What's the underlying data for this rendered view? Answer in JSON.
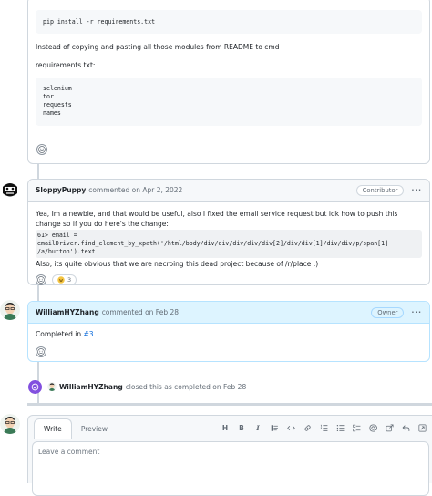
{
  "first_comment": {
    "code1": "pip install -r requirements.txt",
    "para1": "Instead of copying and pasting all those modules from README to cmd",
    "para2": "requirements.txt:",
    "code2_lines": [
      "selenium",
      "tor",
      "requests",
      "names"
    ]
  },
  "comment2": {
    "author": "SloppyPuppy",
    "meta": "commented on Apr 2, 2022",
    "role": "Contributor",
    "body1": "Yea, Im a newbie, and that would be useful, also I fixed the email service request but idk how to push this change so if you do here's the change:",
    "code_line1": "61> email = emailDriver.find_element_by_xpath('/html/body/div/div/div/div/div[2]/div/div[1]/div/div/p/span[1]",
    "code_line2": "/a/button').text",
    "body2": "Also, its quite obvious that we are necroing this dead project because of /r/place :)",
    "reaction_count": "3"
  },
  "comment3": {
    "author": "WilliamHYZhang",
    "meta": "commented on Feb 28",
    "role": "Owner",
    "body_prefix": "Completed in ",
    "body_link": "#3"
  },
  "event": {
    "author": "WilliamHYZhang",
    "text": "closed this as completed on Feb 28"
  },
  "editor": {
    "tab_write": "Write",
    "tab_preview": "Preview",
    "placeholder": "Leave a comment",
    "toolbar_icons": [
      "heading-icon",
      "bold-icon",
      "italic-icon",
      "quote-icon",
      "code-icon",
      "link-icon",
      "ordered-list-icon",
      "unordered-list-icon",
      "task-list-icon",
      "mention-icon",
      "reference-icon",
      "undo-icon",
      "fullscreen-icon"
    ]
  },
  "colors": {
    "accent": "#0969da",
    "closed_purple": "#8250df",
    "owner_header": "#ddf4ff"
  }
}
